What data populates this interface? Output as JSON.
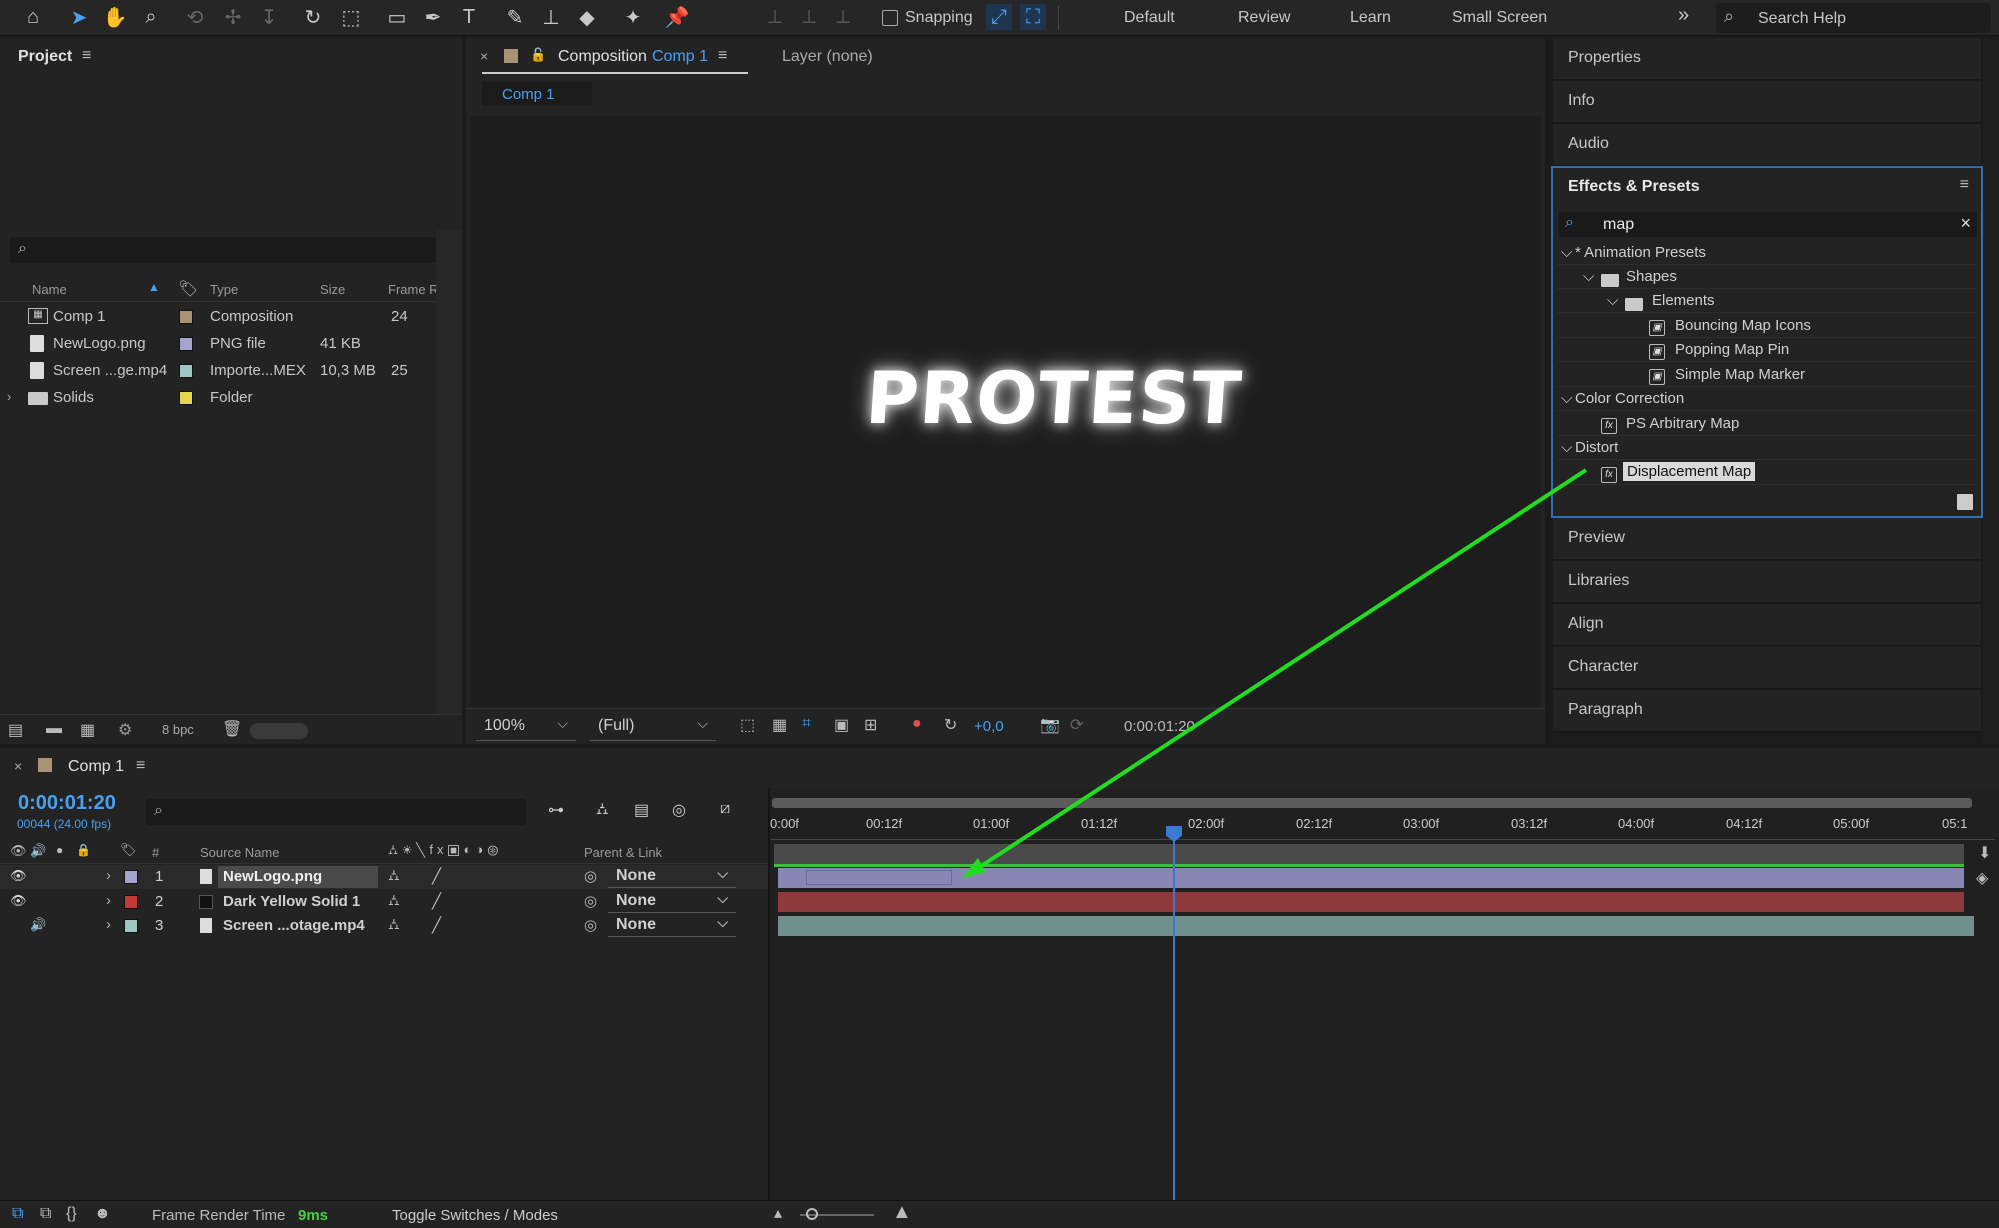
{
  "toolbar": {
    "snapping_label": "Snapping",
    "workspaces": [
      "Default",
      "Review",
      "Learn",
      "Small Screen"
    ],
    "more": "»",
    "search_placeholder": "Search Help"
  },
  "project": {
    "title": "Project",
    "columns": [
      "Name",
      "Type",
      "Size",
      "Frame Ra..."
    ],
    "items": [
      {
        "name": "Comp 1",
        "type": "Composition",
        "size": "",
        "fps": "24",
        "color": "#a89376"
      },
      {
        "name": "NewLogo.png",
        "type": "PNG file",
        "size": "41 KB",
        "fps": "",
        "color": "#a6a3cc"
      },
      {
        "name": "Screen ...ge.mp4",
        "type": "Importe...MEX",
        "size": "10,3 MB",
        "fps": "25",
        "color": "#9ec7c4"
      },
      {
        "name": "Solids",
        "type": "Folder",
        "size": "",
        "fps": "",
        "color": "#e6d84e"
      }
    ],
    "bpc": "8 bpc"
  },
  "composition": {
    "tab_prefix": "Composition",
    "tab_name": "Comp 1",
    "layer_tab": "Layer (none)",
    "subtab": "Comp 1",
    "canvas_text": "PROTEST",
    "zoom": "100%",
    "resolution": "(Full)",
    "exposure": "+0,0",
    "timecode": "0:00:01:20"
  },
  "right_panels": {
    "top": [
      "Properties",
      "Info",
      "Audio"
    ],
    "bottom": [
      "Preview",
      "Libraries",
      "Align",
      "Character",
      "Paragraph"
    ]
  },
  "effects": {
    "title": "Effects & Presets",
    "search_value": "map",
    "tree": [
      {
        "label": "* Animation Presets",
        "kind": "group"
      },
      {
        "label": "Shapes",
        "kind": "folder"
      },
      {
        "label": "Elements",
        "kind": "folder"
      },
      {
        "label": "Bouncing Map Icons",
        "kind": "preset"
      },
      {
        "label": "Popping Map Pin",
        "kind": "preset"
      },
      {
        "label": "Simple Map Marker",
        "kind": "preset"
      },
      {
        "label": "Color Correction",
        "kind": "group"
      },
      {
        "label": "PS Arbitrary Map",
        "kind": "effect"
      },
      {
        "label": "Distort",
        "kind": "group"
      },
      {
        "label": "Displacement Map",
        "kind": "effect"
      }
    ]
  },
  "timeline": {
    "comp_name": "Comp 1",
    "timecode": "0:00:01:20",
    "frames": "00044 (24.00 fps)",
    "header": {
      "num": "#",
      "source": "Source Name",
      "parent": "Parent & Link"
    },
    "ruler": [
      "0:00f",
      "00:12f",
      "01:00f",
      "01:12f",
      "02:00f",
      "02:12f",
      "03:00f",
      "03:12f",
      "04:00f",
      "04:12f",
      "05:00f",
      "05:1"
    ],
    "layers": [
      {
        "num": "1",
        "name": "NewLogo.png",
        "parent": "None",
        "color": "#a6a3cc"
      },
      {
        "num": "2",
        "name": "Dark Yellow Solid 1",
        "parent": "None",
        "color": "#c03a3a"
      },
      {
        "num": "3",
        "name": "Screen ...otage.mp4",
        "parent": "None",
        "color": "#9ec7c4"
      }
    ],
    "status": {
      "label": "Frame Render Time",
      "value": "9ms",
      "toggle": "Toggle Switches / Modes"
    }
  }
}
